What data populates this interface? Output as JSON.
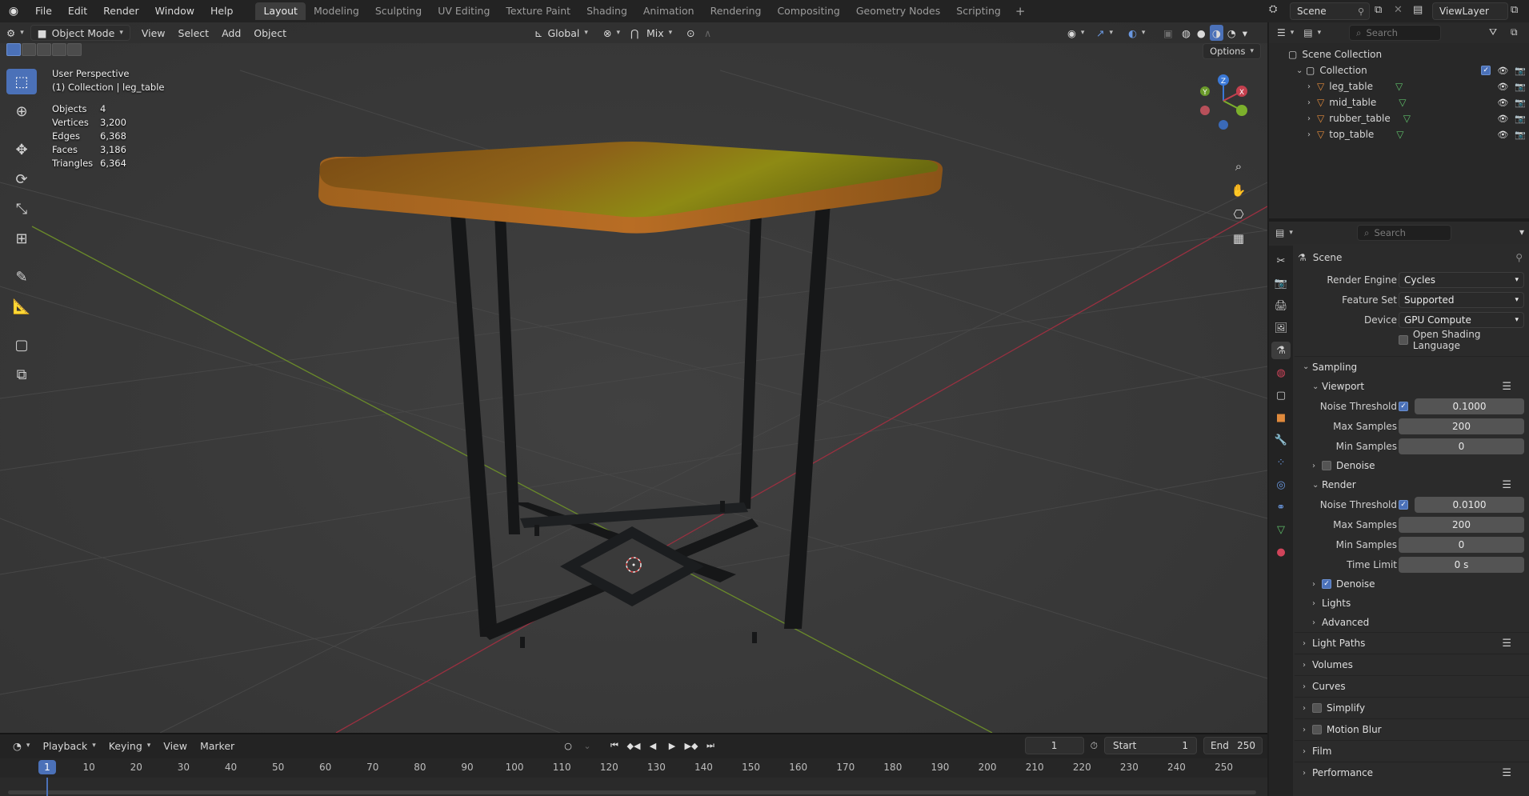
{
  "topbar": {
    "menus": [
      "File",
      "Edit",
      "Render",
      "Window",
      "Help"
    ],
    "workspaces": [
      "Layout",
      "Modeling",
      "Sculpting",
      "UV Editing",
      "Texture Paint",
      "Shading",
      "Animation",
      "Rendering",
      "Compositing",
      "Geometry Nodes",
      "Scripting"
    ],
    "active_workspace": "Layout",
    "add_workspace": "+",
    "scene_name": "Scene",
    "view_layer": "ViewLayer"
  },
  "viewport": {
    "mode": "Object Mode",
    "menus": [
      "View",
      "Select",
      "Add",
      "Object"
    ],
    "transform_orientation": "Global",
    "snap_mode": "Mix",
    "options_label": "Options",
    "overlay_title": "User Perspective",
    "overlay_subtitle": "(1) Collection | leg_table",
    "stats": [
      {
        "label": "Objects",
        "value": "4"
      },
      {
        "label": "Vertices",
        "value": "3,200"
      },
      {
        "label": "Edges",
        "value": "6,368"
      },
      {
        "label": "Faces",
        "value": "3,186"
      },
      {
        "label": "Triangles",
        "value": "6,364"
      }
    ],
    "gizmo": {
      "x": "X",
      "y": "Y",
      "z": "Z"
    }
  },
  "timeline": {
    "menus": [
      "Playback",
      "Keying",
      "View",
      "Marker"
    ],
    "current_frame": "1",
    "start_label": "Start",
    "start": "1",
    "end_label": "End",
    "end": "250",
    "ticks": [
      "1",
      "10",
      "20",
      "30",
      "40",
      "50",
      "60",
      "70",
      "80",
      "90",
      "100",
      "110",
      "120",
      "130",
      "140",
      "150",
      "160",
      "170",
      "180",
      "190",
      "200",
      "210",
      "220",
      "230",
      "240",
      "250"
    ]
  },
  "outliner": {
    "search_placeholder": "Search",
    "root": "Scene Collection",
    "collection": "Collection",
    "objects": [
      "leg_table",
      "mid_table",
      "rubber_table",
      "top_table"
    ]
  },
  "properties": {
    "search_placeholder": "Search",
    "context": "Scene",
    "render_engine_label": "Render Engine",
    "render_engine": "Cycles",
    "feature_set_label": "Feature Set",
    "feature_set": "Supported",
    "device_label": "Device",
    "device": "GPU Compute",
    "osl_label": "Open Shading Language",
    "sampling": "Sampling",
    "viewport": "Viewport",
    "noise_threshold_label": "Noise Threshold",
    "viewport_noise": "0.1000",
    "max_samples_label": "Max Samples",
    "viewport_max": "200",
    "min_samples_label": "Min Samples",
    "viewport_min": "0",
    "denoise_label": "Denoise",
    "render": "Render",
    "render_noise": "0.0100",
    "render_max": "200",
    "render_min": "0",
    "time_limit_label": "Time Limit",
    "time_limit": "0 s",
    "lights": "Lights",
    "advanced": "Advanced",
    "sections": [
      "Light Paths",
      "Volumes",
      "Curves",
      "Simplify",
      "Motion Blur",
      "Film",
      "Performance"
    ]
  },
  "colors": {
    "accent": "#4b71b8",
    "x_axis": "#c4404e",
    "y_axis": "#7cb02c",
    "z_axis": "#3a78d6",
    "table_top": "#8a5a1c",
    "legs": "#141516"
  }
}
